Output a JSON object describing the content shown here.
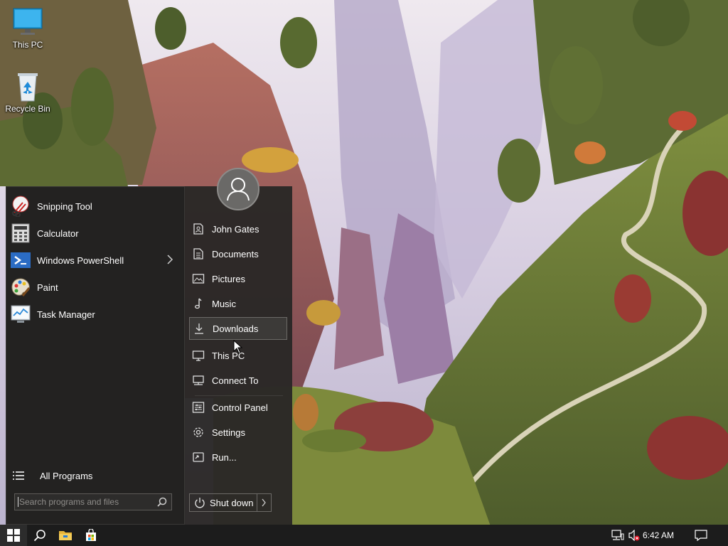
{
  "desktop": {
    "icons": [
      {
        "label": "This PC",
        "icon": "monitor-icon"
      },
      {
        "label": "Recycle Bin",
        "icon": "recycle-bin-icon"
      }
    ]
  },
  "start_menu": {
    "pinned_programs": [
      {
        "label": "Snipping Tool",
        "icon": "snipping-tool-icon"
      },
      {
        "label": "Calculator",
        "icon": "calculator-icon"
      },
      {
        "label": "Windows PowerShell",
        "icon": "powershell-icon",
        "submenu_arrow": true
      },
      {
        "label": "Paint",
        "icon": "paint-palette-icon"
      },
      {
        "label": "Task Manager",
        "icon": "task-manager-icon"
      }
    ],
    "all_programs_label": "All Programs",
    "search": {
      "placeholder": "Search programs and files",
      "value": ""
    },
    "user": {
      "avatar": "user-avatar-icon"
    },
    "places": [
      {
        "label": "John Gates",
        "icon": "user-folder-icon"
      },
      {
        "label": "Documents",
        "icon": "document-icon"
      },
      {
        "label": "Pictures",
        "icon": "picture-icon"
      },
      {
        "label": "Music",
        "icon": "music-note-icon"
      },
      {
        "label": "Downloads",
        "icon": "download-arrow-icon",
        "highlighted": true
      },
      {
        "label": "This PC",
        "icon": "monitor-icon"
      },
      {
        "label": "Connect To",
        "icon": "network-icon"
      },
      {
        "label": "Control Panel",
        "icon": "control-panel-icon"
      },
      {
        "label": "Settings",
        "icon": "gear-icon"
      },
      {
        "label": "Run...",
        "icon": "run-icon"
      }
    ],
    "shutdown": {
      "label": "Shut down",
      "icon": "power-icon",
      "more_icon": "chevron-right-icon"
    }
  },
  "taskbar": {
    "buttons": [
      {
        "name": "start-button",
        "icon": "windows-logo-icon"
      },
      {
        "name": "search-button",
        "icon": "search-icon"
      },
      {
        "name": "file-explorer-button",
        "icon": "folder-icon"
      },
      {
        "name": "store-button",
        "icon": "store-bag-icon"
      }
    ],
    "tray": {
      "icons": [
        "network-wired-icon",
        "speaker-muted-icon"
      ],
      "clock": "6:42 AM",
      "notification_icon": "notification-icon"
    }
  },
  "colors": {
    "menu_bg": "#232221",
    "menu_right_bg": "#2a2826",
    "highlight_border": "#6c6a67",
    "taskbar_bg": "#1c1c1c",
    "accent_blue": "#2b7cd3"
  }
}
